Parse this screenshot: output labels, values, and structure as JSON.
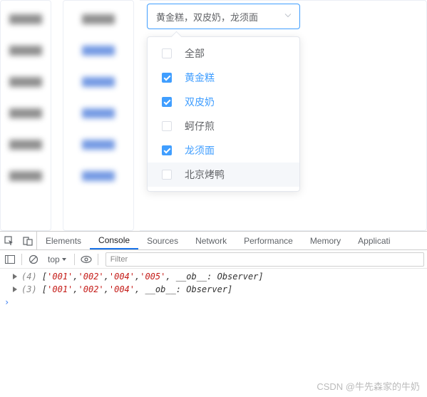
{
  "select": {
    "value": "黄金糕，双皮奶，龙须面",
    "options": [
      {
        "label": "全部",
        "checked": false,
        "hover": false
      },
      {
        "label": "黄金糕",
        "checked": true,
        "hover": false
      },
      {
        "label": "双皮奶",
        "checked": true,
        "hover": false
      },
      {
        "label": "蚵仔煎",
        "checked": false,
        "hover": false
      },
      {
        "label": "龙须面",
        "checked": true,
        "hover": false
      },
      {
        "label": "北京烤鸭",
        "checked": false,
        "hover": true
      }
    ]
  },
  "devtools": {
    "tabs": [
      "Elements",
      "Console",
      "Sources",
      "Network",
      "Performance",
      "Memory",
      "Applicati"
    ],
    "activeTab": "Console",
    "context": "top",
    "filterPlaceholder": "Filter",
    "logs": [
      {
        "count": "(4)",
        "items": [
          "'001'",
          "'002'",
          "'004'",
          "'005'"
        ],
        "suffix": ", __ob__: Observer]"
      },
      {
        "count": "(3)",
        "items": [
          "'001'",
          "'002'",
          "'004'"
        ],
        "suffix": ", __ob__: Observer]"
      }
    ],
    "prompt": "›"
  },
  "watermark": "CSDN @牛先森家的牛奶"
}
